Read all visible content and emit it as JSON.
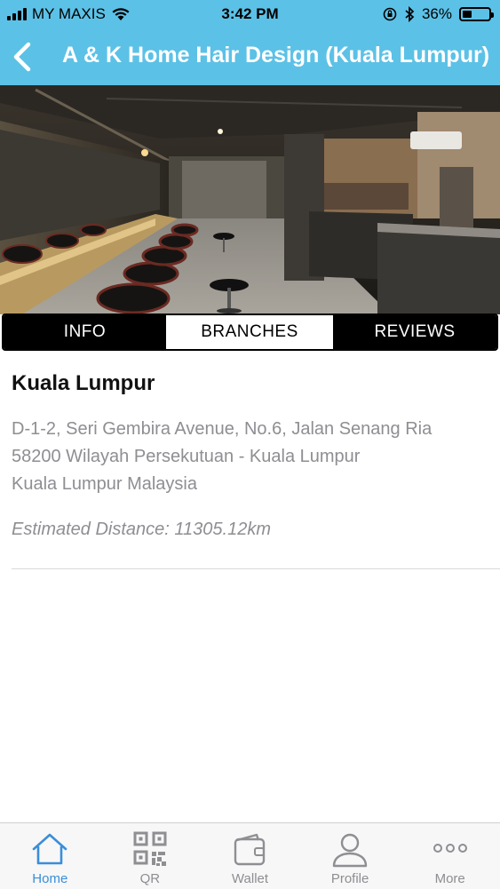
{
  "status_bar": {
    "carrier": "MY MAXIS",
    "time": "3:42 PM",
    "battery": "36%",
    "battery_level": 0.36
  },
  "nav": {
    "back_icon": "chevron-left-icon",
    "title": "A & K Home Hair Design (Kuala Lumpur)"
  },
  "tabs": [
    {
      "label": "INFO",
      "active": false
    },
    {
      "label": "BRANCHES",
      "active": true
    },
    {
      "label": "REVIEWS",
      "active": false
    }
  ],
  "branch": {
    "name": "Kuala Lumpur",
    "address_line1": "D-1-2, Seri Gembira Avenue, No.6, Jalan Senang Ria",
    "address_line2": "58200 Wilayah Persekutuan - Kuala Lumpur",
    "address_line3": "Kuala Lumpur Malaysia",
    "distance": "Estimated Distance: 11305.12km"
  },
  "tabbar": [
    {
      "label": "Home",
      "icon": "home-icon",
      "active": true
    },
    {
      "label": "QR",
      "icon": "qr-code-icon",
      "active": false
    },
    {
      "label": "Wallet",
      "icon": "wallet-icon",
      "active": false
    },
    {
      "label": "Profile",
      "icon": "profile-icon",
      "active": false
    },
    {
      "label": "More",
      "icon": "more-dots-icon",
      "active": false
    }
  ],
  "colors": {
    "header": "#5cc1e6",
    "active_tab_icon": "#3a8ed8",
    "inactive_tab_icon": "#8e8e93"
  }
}
